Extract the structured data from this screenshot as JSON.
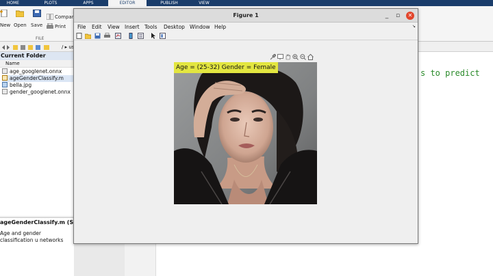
{
  "matlab": {
    "tabs": [
      "HOME",
      "PLOTS",
      "APPS",
      "EDITOR",
      "PUBLISH",
      "VIEW"
    ],
    "toolstrip": {
      "new_label": "New",
      "open_label": "Open",
      "save_label": "Save",
      "compare_label": "Compar",
      "print_label": "Print",
      "group_label": "FILE"
    },
    "address_path": "/  ▸  usr",
    "current_folder": {
      "title": "Current Folder",
      "column_name": "Name",
      "files": [
        {
          "name": "age_googlenet.onnx",
          "selected": false
        },
        {
          "name": "ageGenderClassify.m",
          "selected": true
        },
        {
          "name": "bella.jpg",
          "selected": false
        },
        {
          "name": "gender_googlenet.onnx",
          "selected": false
        }
      ]
    },
    "details": {
      "title": "ageGenderClassify.m  (Script)",
      "description": "Age and gender classification u networks"
    },
    "editor_visible_text": "s to predict"
  },
  "figure": {
    "title": "Figure 1",
    "menu": [
      "File",
      "Edit",
      "View",
      "Insert",
      "Tools",
      "Desktop",
      "Window",
      "Help"
    ],
    "plot_title": "Age = (25-32) Gender = Female",
    "colors": {
      "title_highlight": "#e3e640",
      "close_button": "#e2452b",
      "matlab_tab_bar": "#1a3d6b"
    },
    "toolbar_icons": [
      "new-figure-icon",
      "open-file-icon",
      "save-icon",
      "print-icon",
      "link-plot-icon",
      "insert-colorbar-icon",
      "insert-legend-icon",
      "edit-plot-icon",
      "property-inspector-icon"
    ],
    "axes_toolbar_icons": [
      "brush-icon",
      "data-tips-icon",
      "pan-icon",
      "zoom-in-icon",
      "zoom-out-icon",
      "restore-view-icon"
    ]
  }
}
